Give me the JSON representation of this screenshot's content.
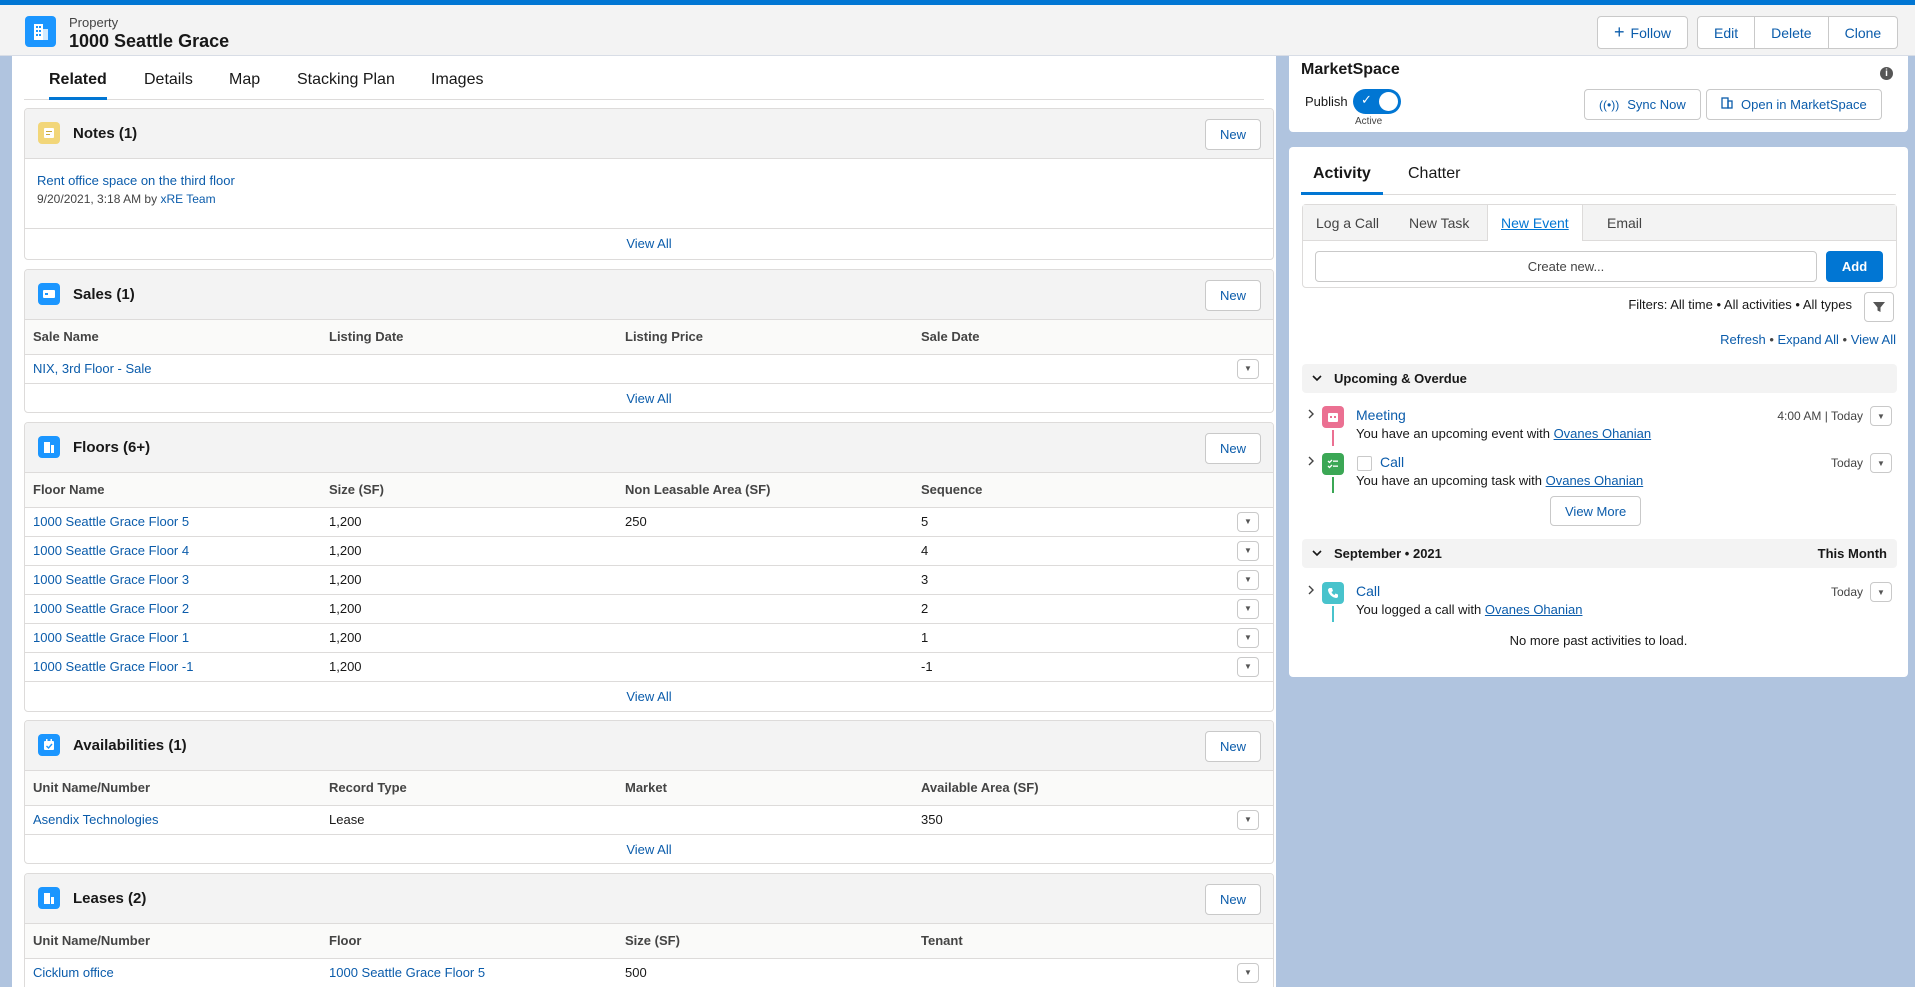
{
  "header": {
    "object_type": "Property",
    "record_name": "1000 Seattle Grace",
    "follow_label": "Follow",
    "edit_label": "Edit",
    "delete_label": "Delete",
    "clone_label": "Clone"
  },
  "tabs": [
    "Related",
    "Details",
    "Map",
    "Stacking Plan",
    "Images"
  ],
  "new_label": "New",
  "view_all_label": "View All",
  "notes": {
    "title": "Notes (1)",
    "note_title": "Rent office space on the third floor",
    "note_date": "9/20/2021, 3:18 AM by",
    "note_author": "xRE Team"
  },
  "sales": {
    "title": "Sales (1)",
    "columns": [
      "Sale Name",
      "Listing Date",
      "Listing Price",
      "Sale Date"
    ],
    "rows": [
      [
        "NIX, 3rd Floor - Sale",
        "",
        "",
        ""
      ]
    ]
  },
  "floors": {
    "title": "Floors (6+)",
    "columns": [
      "Floor Name",
      "Size (SF)",
      "Non Leasable Area (SF)",
      "Sequence"
    ],
    "rows": [
      [
        "1000 Seattle Grace Floor 5",
        "1,200",
        "250",
        "5"
      ],
      [
        "1000 Seattle Grace Floor 4",
        "1,200",
        "",
        "4"
      ],
      [
        "1000 Seattle Grace Floor 3",
        "1,200",
        "",
        "3"
      ],
      [
        "1000 Seattle Grace Floor 2",
        "1,200",
        "",
        "2"
      ],
      [
        "1000 Seattle Grace Floor 1",
        "1,200",
        "",
        "1"
      ],
      [
        "1000 Seattle Grace Floor -1",
        "1,200",
        "",
        "-1"
      ]
    ]
  },
  "availabilities": {
    "title": "Availabilities (1)",
    "columns": [
      "Unit Name/Number",
      "Record Type",
      "Market",
      "Available Area (SF)"
    ],
    "rows": [
      [
        "Asendix Technologies",
        "Lease",
        "",
        "350"
      ]
    ]
  },
  "leases": {
    "title": "Leases (2)",
    "columns": [
      "Unit Name/Number",
      "Floor",
      "Size (SF)",
      "Tenant"
    ],
    "rows": [
      [
        "Cicklum office",
        "1000 Seattle Grace Floor 5",
        "500",
        ""
      ]
    ]
  },
  "marketspace": {
    "title": "MarketSpace",
    "publish_label": "Publish",
    "toggle_state": "Active",
    "sync_label": "Sync Now",
    "open_label": "Open in MarketSpace"
  },
  "activity": {
    "tabs": [
      "Activity",
      "Chatter"
    ],
    "composer_tabs": [
      "Log a Call",
      "New Task",
      "New Event",
      "Email"
    ],
    "create_placeholder": "Create new...",
    "add_label": "Add",
    "filters_text": "Filters: All time • All activities • All types",
    "refresh": "Refresh",
    "expand_all": "Expand All",
    "view_all": "View All",
    "upcoming_title": "Upcoming & Overdue",
    "meeting_title": "Meeting",
    "meeting_desc": "You have an upcoming event with",
    "meeting_person": "Ovanes Ohanian",
    "meeting_time": "4:00 AM | Today",
    "call_title": "Call",
    "call_desc": "You have an upcoming task with",
    "call_person": "Ovanes Ohanian",
    "call_time": "Today",
    "view_more": "View More",
    "month_title": "September • 2021",
    "month_right": "This Month",
    "past_call_title": "Call",
    "past_call_desc": "You logged a call with",
    "past_call_person": "Ovanes Ohanian",
    "past_call_time": "Today",
    "no_more": "No more past activities to load."
  },
  "colors": {
    "brand": "#0176d3",
    "link": "#0b5cab",
    "notes_icon": "#f2d679",
    "sales_icon": "#1b96ff",
    "floors_icon": "#1b96ff",
    "meeting_icon": "#eb7092",
    "task_icon": "#3ba755",
    "call_icon": "#48c3cc"
  }
}
